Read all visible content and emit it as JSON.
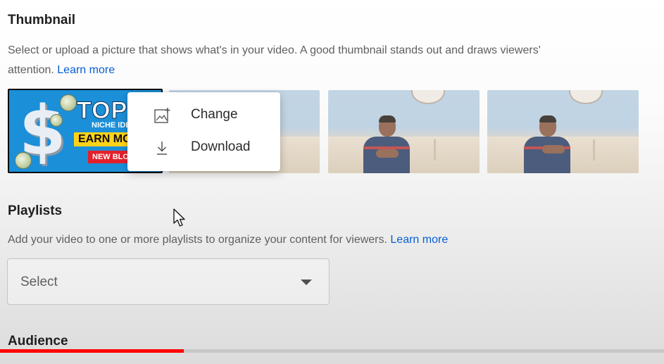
{
  "thumbnail": {
    "title": "Thumbnail",
    "description": "Select or upload a picture that shows what's in your video. A good thumbnail stands out and draws viewers'",
    "description_line2": "attention.",
    "learn_more": "Learn more",
    "custom_thumb": {
      "top": "TOP",
      "niche": "NICHE IDE",
      "earn": "EARN MO",
      "new_blog": "NEW BLO"
    },
    "menu": {
      "change_label": "Change",
      "download_label": "Download"
    }
  },
  "playlists": {
    "title": "Playlists",
    "description": "Add your video to one or more playlists to organize your content for viewers.",
    "learn_more": "Learn more",
    "select_value": "Select"
  },
  "audience": {
    "title": "Audience"
  },
  "progress": {
    "fraction": 0.277,
    "color": "#ff0000"
  },
  "colors": {
    "link": "#065fd4",
    "accent_red": "#ff0000"
  },
  "icons": {
    "change": "add-photo-icon",
    "download": "download-icon",
    "dropdown": "arrow-drop-down-icon",
    "cursor": "mouse-pointer-icon"
  }
}
